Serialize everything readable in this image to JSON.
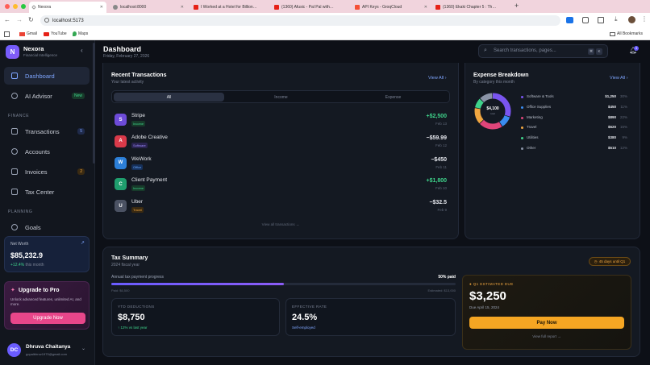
{
  "browser": {
    "tabs": [
      {
        "title": "Nexora",
        "active": true
      },
      {
        "title": "localhost:8000",
        "active": false
      },
      {
        "title": "I Worked at a Hotel for Billion…",
        "active": false
      },
      {
        "title": "(1360) Afusic - Pal Pal with…",
        "active": false
      },
      {
        "title": "API Keys - GroqCloud",
        "active": false
      },
      {
        "title": "(1360) Ekaki Chapter 5 : Th…",
        "active": false
      }
    ],
    "url": "localhost:5173",
    "bookmarks": [
      "Gmail",
      "YouTube",
      "Maps"
    ],
    "all_bookmarks": "All Bookmarks"
  },
  "brand": {
    "initial": "N",
    "name": "Nexora",
    "tagline": "Financial Intelligence"
  },
  "nav": {
    "dashboard": "Dashboard",
    "ai_advisor": "AI Advisor",
    "ai_badge": "New",
    "finance_section": "FINANCE",
    "transactions": "Transactions",
    "transactions_badge": "5",
    "accounts": "Accounts",
    "invoices": "Invoices",
    "invoices_badge": "2",
    "tax_center": "Tax Center",
    "planning_section": "PLANNING",
    "goals": "Goals"
  },
  "networth": {
    "label": "Net Worth",
    "value": "$85,232.9",
    "change": "+12.4%",
    "period": "this month"
  },
  "upgrade": {
    "title": "Upgrade to Pro",
    "desc": "Unlock advanced features, unlimited AI, and more.",
    "button": "Upgrade Now"
  },
  "user": {
    "initials": "DC",
    "name": "Dhruva Chaitanya",
    "email": "gopalbhruv1975@gmail.com"
  },
  "header": {
    "title": "Dashboard",
    "date": "Friday, February 27, 2026",
    "search_placeholder": "Search transactions, pages...",
    "kbd1": "⌘",
    "kbd2": "K",
    "notif_count": "3"
  },
  "recent": {
    "title": "Recent Transactions",
    "subtitle": "Your latest activity",
    "view_all": "View All",
    "filters": [
      "All",
      "Income",
      "Expense"
    ],
    "items": [
      {
        "initial": "S",
        "name": "Stripe",
        "tag": "Income",
        "amount": "+$2,500",
        "date": "Feb 13",
        "color": "#6d4bd8",
        "tagbg": "#173a2a",
        "tagfg": "#3fd38b",
        "amtcolor": "#3fd38b"
      },
      {
        "initial": "A",
        "name": "Adobe Creative",
        "tag": "Software",
        "amount": "−$59.99",
        "date": "Feb 12",
        "color": "#d93a4a",
        "tagbg": "#2a2350",
        "tagfg": "#9d8cff",
        "amtcolor": "#e6e8ee"
      },
      {
        "initial": "W",
        "name": "WeWork",
        "tag": "Office",
        "amount": "−$450",
        "date": "Feb 11",
        "color": "#2c7fd8",
        "tagbg": "#16305a",
        "tagfg": "#6aa8ff",
        "amtcolor": "#e6e8ee"
      },
      {
        "initial": "C",
        "name": "Client Payment",
        "tag": "Income",
        "amount": "+$1,800",
        "date": "Feb 10",
        "color": "#1f9e6e",
        "tagbg": "#173a2a",
        "tagfg": "#3fd38b",
        "amtcolor": "#3fd38b"
      },
      {
        "initial": "U",
        "name": "Uber",
        "tag": "Travel",
        "amount": "−$32.5",
        "date": "Feb 9",
        "color": "#4b5263",
        "tagbg": "#3a2a12",
        "tagfg": "#f0a640",
        "amtcolor": "#e6e8ee"
      }
    ],
    "view_all_link": "View all transactions →"
  },
  "expense": {
    "title": "Expense Breakdown",
    "subtitle": "By category this month",
    "view_all": "View All",
    "total": "$4,100",
    "total_label": "total",
    "items": [
      {
        "name": "Software & Tools",
        "value": "$1,250",
        "pct": "30%",
        "amount": 1250,
        "color": "#7a55f0"
      },
      {
        "name": "Office Supplies",
        "value": "$450",
        "pct": "11%",
        "amount": 450,
        "color": "#3a8cf0"
      },
      {
        "name": "Marketing",
        "value": "$890",
        "pct": "22%",
        "amount": 890,
        "color": "#e0457a"
      },
      {
        "name": "Travel",
        "value": "$620",
        "pct": "15%",
        "amount": 620,
        "color": "#f0a640"
      },
      {
        "name": "Utilities",
        "value": "$380",
        "pct": "9%",
        "amount": 380,
        "color": "#3fd38b"
      },
      {
        "name": "Other",
        "value": "$510",
        "pct": "12%",
        "amount": 510,
        "color": "#8a93a6"
      }
    ]
  },
  "tax": {
    "title": "Tax Summary",
    "subtitle": "2024 fiscal year",
    "days_badge": "45 days until Q1",
    "progress_label": "Annual tax payment progress",
    "progress_value": "50% paid",
    "progress": 0.5,
    "paid": "Paid: $6,500",
    "estimated": "Estimated: $13,000",
    "ytd_label": "YTD DEDUCTIONS",
    "ytd_value": "$8,750",
    "ytd_change": "12% vs last year",
    "rate_label": "EFFECTIVE RATE",
    "rate_value": "24.5%",
    "rate_sub": "Self-employed",
    "q1_label": "Q1 ESTIMATED DUE",
    "q1_value": "$3,250",
    "q1_due": "Due April 15, 2024",
    "pay_button": "Pay Now",
    "full_report": "View full report →"
  }
}
